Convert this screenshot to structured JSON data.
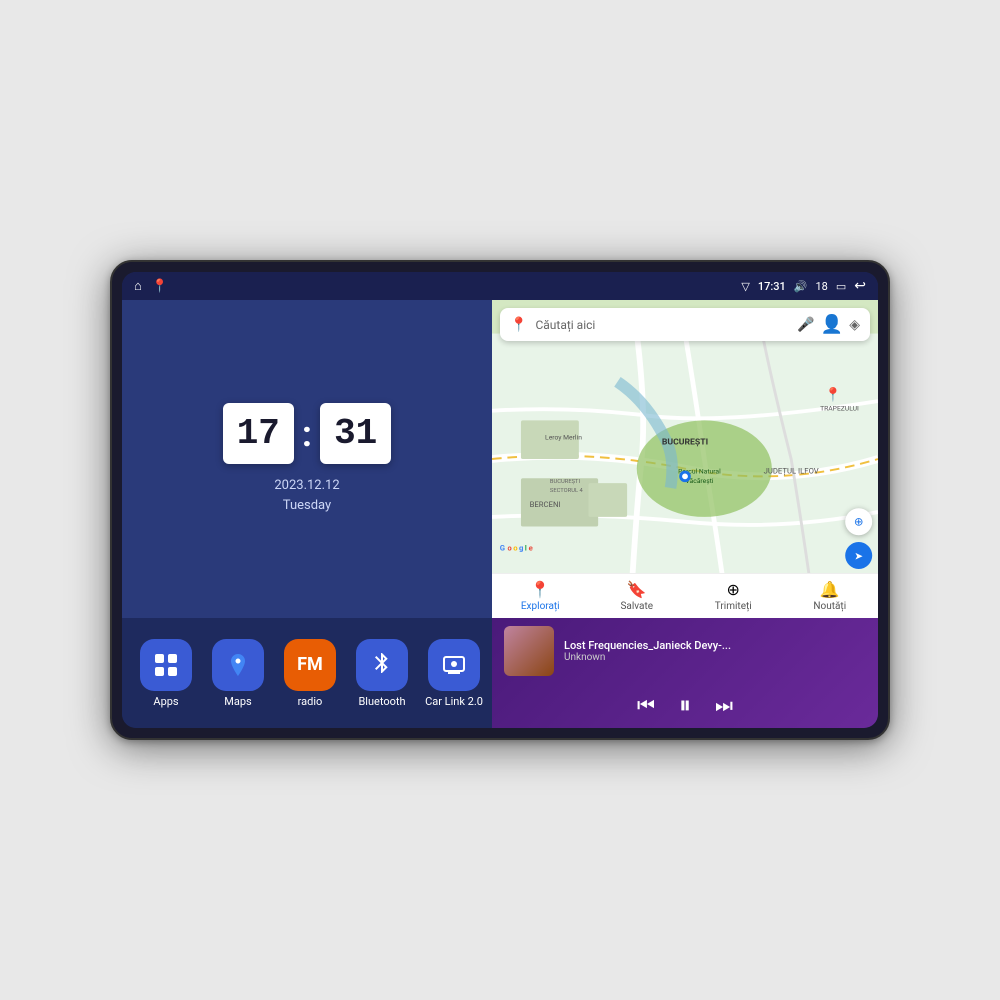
{
  "device": {
    "status_bar": {
      "left_icons": [
        "home",
        "maps"
      ],
      "signal_icon": "▽",
      "time": "17:31",
      "volume_icon": "🔊",
      "battery_level": "18",
      "battery_icon": "🔋",
      "back_icon": "↩"
    },
    "clock": {
      "hour": "17",
      "minute": "31",
      "date": "2023.12.12",
      "day": "Tuesday"
    },
    "map": {
      "search_placeholder": "Căutați aici",
      "nav_items": [
        {
          "label": "Explorați",
          "icon": "📍",
          "active": true
        },
        {
          "label": "Salvate",
          "icon": "🔖",
          "active": false
        },
        {
          "label": "Trimiteți",
          "icon": "⊕",
          "active": false
        },
        {
          "label": "Noutăți",
          "icon": "🔔",
          "active": false
        }
      ],
      "location_labels": [
        "BUCURESTI",
        "JUDEȚUL ILFOV",
        "BERCENI",
        "TRAPEZULUI",
        "Parcul Natural Văcărești",
        "Leroy Merlin",
        "BUCUREȘTI SECTORUL 4"
      ]
    },
    "apps": [
      {
        "id": "apps",
        "label": "Apps",
        "icon": "⊞",
        "color": "#3a5bd4"
      },
      {
        "id": "maps",
        "label": "Maps",
        "icon": "📍",
        "color": "#3a5bd4"
      },
      {
        "id": "radio",
        "label": "radio",
        "icon": "📻",
        "color": "#e85d04"
      },
      {
        "id": "bluetooth",
        "label": "Bluetooth",
        "icon": "⚡",
        "color": "#3a5bd4"
      },
      {
        "id": "carlink",
        "label": "Car Link 2.0",
        "icon": "📱",
        "color": "#3a5bd4"
      }
    ],
    "music": {
      "title": "Lost Frequencies_Janieck Devy-...",
      "artist": "Unknown",
      "controls": {
        "prev": "⏮",
        "play": "⏸",
        "next": "⏭"
      }
    }
  }
}
